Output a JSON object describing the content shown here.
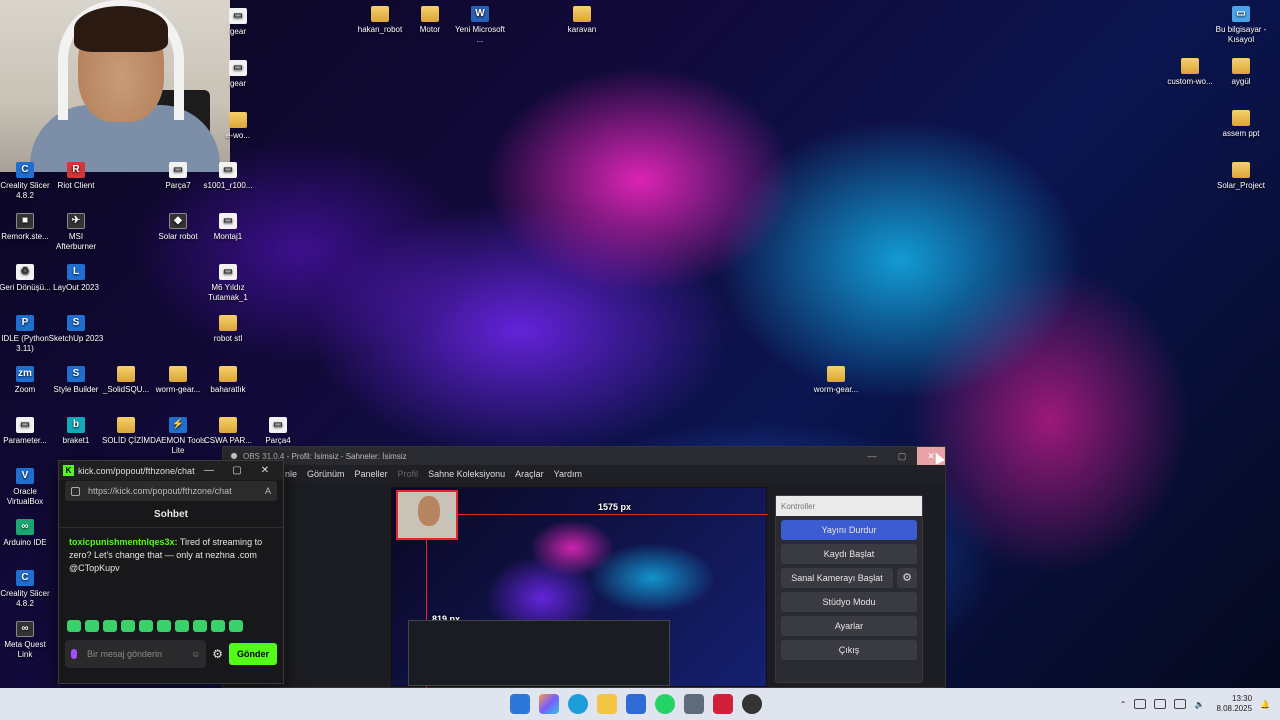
{
  "desktop": {
    "icons_left_col1": [
      "Creality Slicer 4.8.2",
      "Remork.ste...",
      "Geri Dönüşü...",
      "IDLE (Python 3.11)",
      "Zoom",
      "Parameter...",
      "Oracle VirtualBox",
      "Arduino IDE",
      "Creality Slicer 4.8.2",
      "Meta Quest Link"
    ],
    "icons_left_col2": [
      "Riot Client",
      "MSI Afterburner",
      "LayOut 2023",
      "SketchUp 2023",
      "Style Builder",
      "braket1"
    ],
    "icons_left_col3": [
      "Solar robot",
      "_SolidSQU...",
      "SOLİD ÇİZİM",
      "Parça7"
    ],
    "icons_left_col4": [
      "s1001_r100...",
      "Montaj1",
      "M6 Yıldız Tutamak_1",
      "robot stl",
      "baharatlık",
      "CSWA PAR...",
      "worm-gear..."
    ],
    "icons_left_misc": [
      "DAEMON Tools Lite",
      "Parça4"
    ],
    "icons_top": [
      "gear",
      "gear",
      "e-wo...",
      "hakan_robot",
      "Motor",
      "Yeni Microsoft ...",
      "karavan"
    ],
    "icons_right": [
      "Bu bilgisayar - Kısayol",
      "custom-wo...",
      "aygül",
      "assem ppt",
      "Solar_Project"
    ],
    "center_icon": "worm-gear..."
  },
  "chat_window": {
    "title": "kick.com/popout/fthzone/chat...",
    "url": "https://kick.com/popout/fthzone/chat",
    "header": "Sohbet",
    "message_user": "toxicpunishmentnlqes3x:",
    "message_text": "Tired of streaming to zero? Let's change that — only at nezhna .com @CTopKupv",
    "input_placeholder": "Bir mesaj gönderin",
    "send_label": "Gönder",
    "accent": "#53fc18"
  },
  "obs": {
    "title": "OBS 31.0.4 - Profil: İsimsiz - Sahneler: İsimsiz",
    "menu": [
      "nle",
      "Görünüm",
      "Paneller",
      "Profil",
      "Sahne Koleksiyonu",
      "Araçlar",
      "Yardım"
    ],
    "preview_width_label": "1575 px",
    "preview_height_label": "819 px",
    "controls_header": "Kontroller",
    "buttons": {
      "stop_stream": "Yayını Durdur",
      "start_record": "Kaydı Başlat",
      "virtual_cam": "Sanal Kamerayı Başlat",
      "studio_mode": "Stüdyo Modu",
      "settings": "Ayarlar",
      "exit": "Çıkış"
    },
    "accent": "#3c5cd2"
  },
  "taskbar": {
    "time": "13:30",
    "date": "8.08.2025"
  }
}
